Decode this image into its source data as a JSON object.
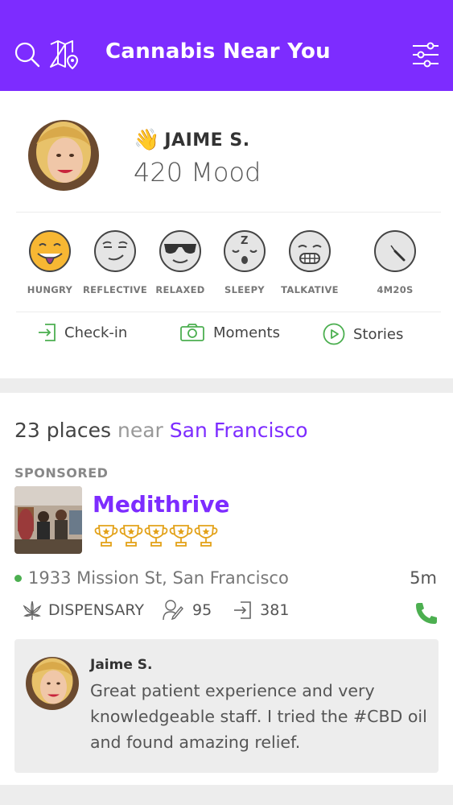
{
  "header": {
    "title": "Cannabis Near You",
    "icons": [
      "search-icon",
      "map-pin-icon",
      "filter-sliders-icon"
    ],
    "accent": "#7d2cff"
  },
  "profile": {
    "wave_emoji": "👋",
    "name": "JAIME S.",
    "mood": "420 Mood"
  },
  "moods": [
    {
      "label": "HUNGRY",
      "icon": "hungry-face-icon"
    },
    {
      "label": "REFLECTIVE",
      "icon": "reflective-face-icon"
    },
    {
      "label": "RELAXED",
      "icon": "relaxed-face-icon"
    },
    {
      "label": "SLEEPY",
      "icon": "sleepy-face-icon"
    },
    {
      "label": "TALKATIVE",
      "icon": "talkative-face-icon"
    },
    {
      "label": "4M20S",
      "icon": "timer-icon"
    }
  ],
  "actions": [
    {
      "label": "Check-in",
      "icon": "checkin-icon"
    },
    {
      "label": "Moments",
      "icon": "camera-icon"
    },
    {
      "label": "Stories",
      "icon": "play-icon"
    }
  ],
  "places": {
    "count_text": "23 places",
    "near_text": "near",
    "city": "San Francisco",
    "sponsored_label": "SPONSORED",
    "listing": {
      "name": "Medithrive",
      "trophy_count": 5,
      "address": "1933 Mission St, San Francisco",
      "distance": "5m",
      "type": "DISPENSARY",
      "reviews": "95",
      "checkins": "381",
      "status_color": "#4caf50"
    },
    "review": {
      "author": "Jaime S.",
      "text": "Great patient experience and very knowledgeable staff. I tried the #CBD oil and found amazing relief."
    }
  }
}
